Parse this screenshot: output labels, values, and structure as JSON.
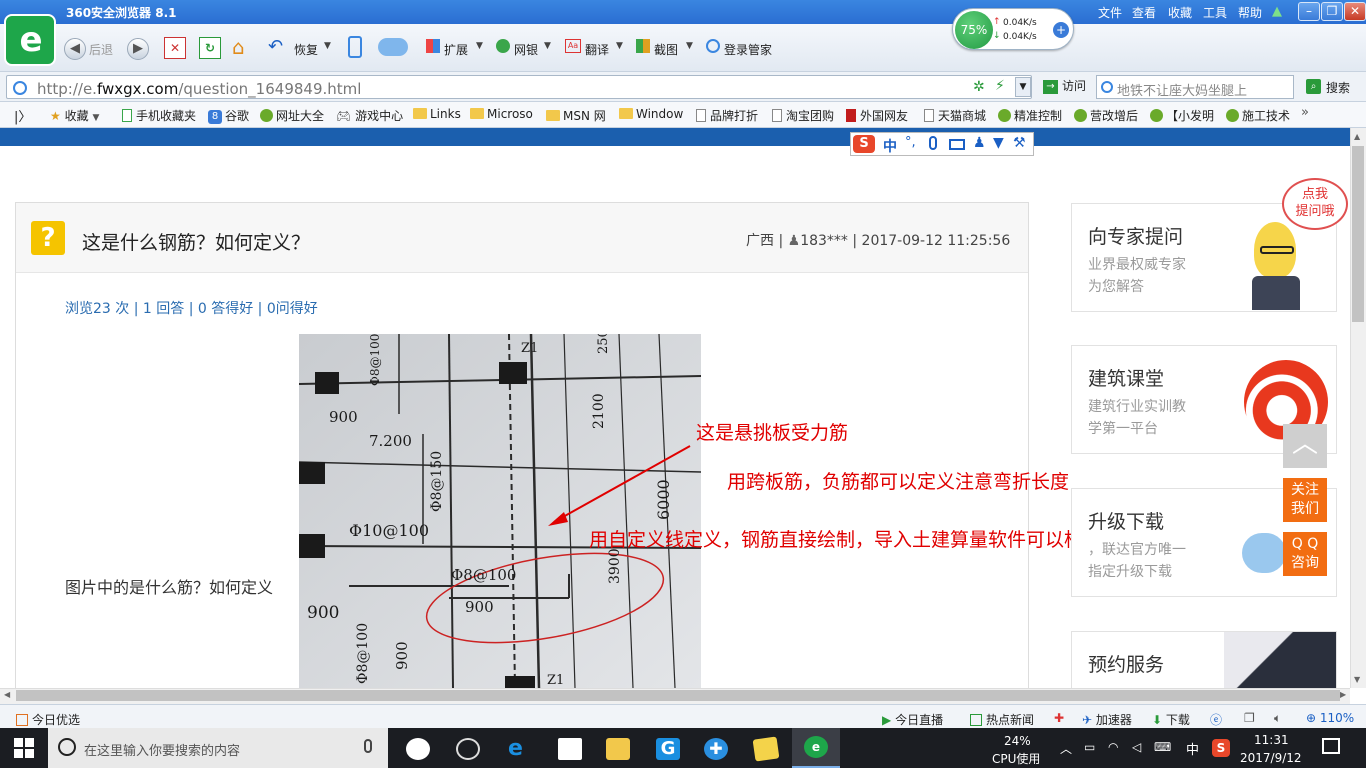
{
  "browser": {
    "title": "360安全浏览器 8.1",
    "menu": [
      "文件",
      "查看",
      "收藏",
      "工具",
      "帮助"
    ],
    "toolbar": {
      "back": "后退",
      "restore": "恢复",
      "extend": "扩展",
      "bank": "网银",
      "translate": "翻译",
      "screenshot": "截图",
      "login": "登录管家"
    },
    "speed": {
      "percent": "75%",
      "up": "0.04K/s",
      "down": "0.04K/s"
    },
    "address": {
      "prefix": "http://e.",
      "domain": "fwxgx.com",
      "path": "/question_1649849.html",
      "go": "访问"
    },
    "search": {
      "placeholder": "地铁不让座大妈坐腿上",
      "button": "搜索"
    },
    "favorites": {
      "star": "收藏",
      "items": [
        "手机收藏夹",
        "谷歌",
        "网址大全",
        "游戏中心",
        "Links",
        "Microso",
        "MSN 网",
        "Window",
        "品牌打折",
        "淘宝团购",
        "外国网友",
        "天猫商城",
        "精准控制",
        "营改增后",
        "【小发明",
        "施工技术"
      ]
    }
  },
  "ime": {
    "zh": "中"
  },
  "question": {
    "title": "这是什么钢筋？如何定义？",
    "meta": "广西 | ",
    "user": "183***",
    "time": " | 2017-09-12 11:25:56",
    "stats": "浏览23 次 | 1 回答 | 0 答得好 | 0问得好",
    "body": "图片中的是什么筋？如何定义"
  },
  "blueprint": {
    "labels": [
      "Z1",
      "250",
      "900",
      "Φ8@100",
      "7.200",
      "2100",
      "Φ8@150",
      "Φ10@100",
      "6000",
      "Φ8@100",
      "900",
      "3900",
      "900",
      "Φ8@100",
      "900",
      "Z1"
    ]
  },
  "annotations": {
    "line1": "这是悬挑板受力筋",
    "line2": "用跨板筋，负筋都可以定义注意弯折长度",
    "line3": "用自定义线定义，钢筋直接绘制，导入土建算量软件可以构件转换"
  },
  "sidebar": {
    "bubble": "点我\n提问哦",
    "cards": [
      {
        "title": "向专家提问",
        "sub1": "业界最权威专家",
        "sub2": "为您解答"
      },
      {
        "title": "建筑课堂",
        "sub1": "建筑行业实训教",
        "sub2": "学第一平台"
      },
      {
        "title": "升级下载",
        "sub1": "，联达官方唯一",
        "sub2": "指定升级下载"
      },
      {
        "title": "预约服务",
        "sub1": "",
        "sub2": ""
      }
    ],
    "follow": "关注\n我们",
    "qq": "Q Q\n咨询"
  },
  "statusbar": {
    "left": "今日优选",
    "live": "今日直播",
    "news": "热点新闻",
    "accel": "加速器",
    "download": "下载",
    "zoom": "110%"
  },
  "taskbar": {
    "search_placeholder": "在这里输入你要搜索的内容",
    "cpu_pct": "24%",
    "cpu_label": "CPU使用",
    "ime": "中",
    "time": "11:31",
    "date": "2017/9/12"
  }
}
